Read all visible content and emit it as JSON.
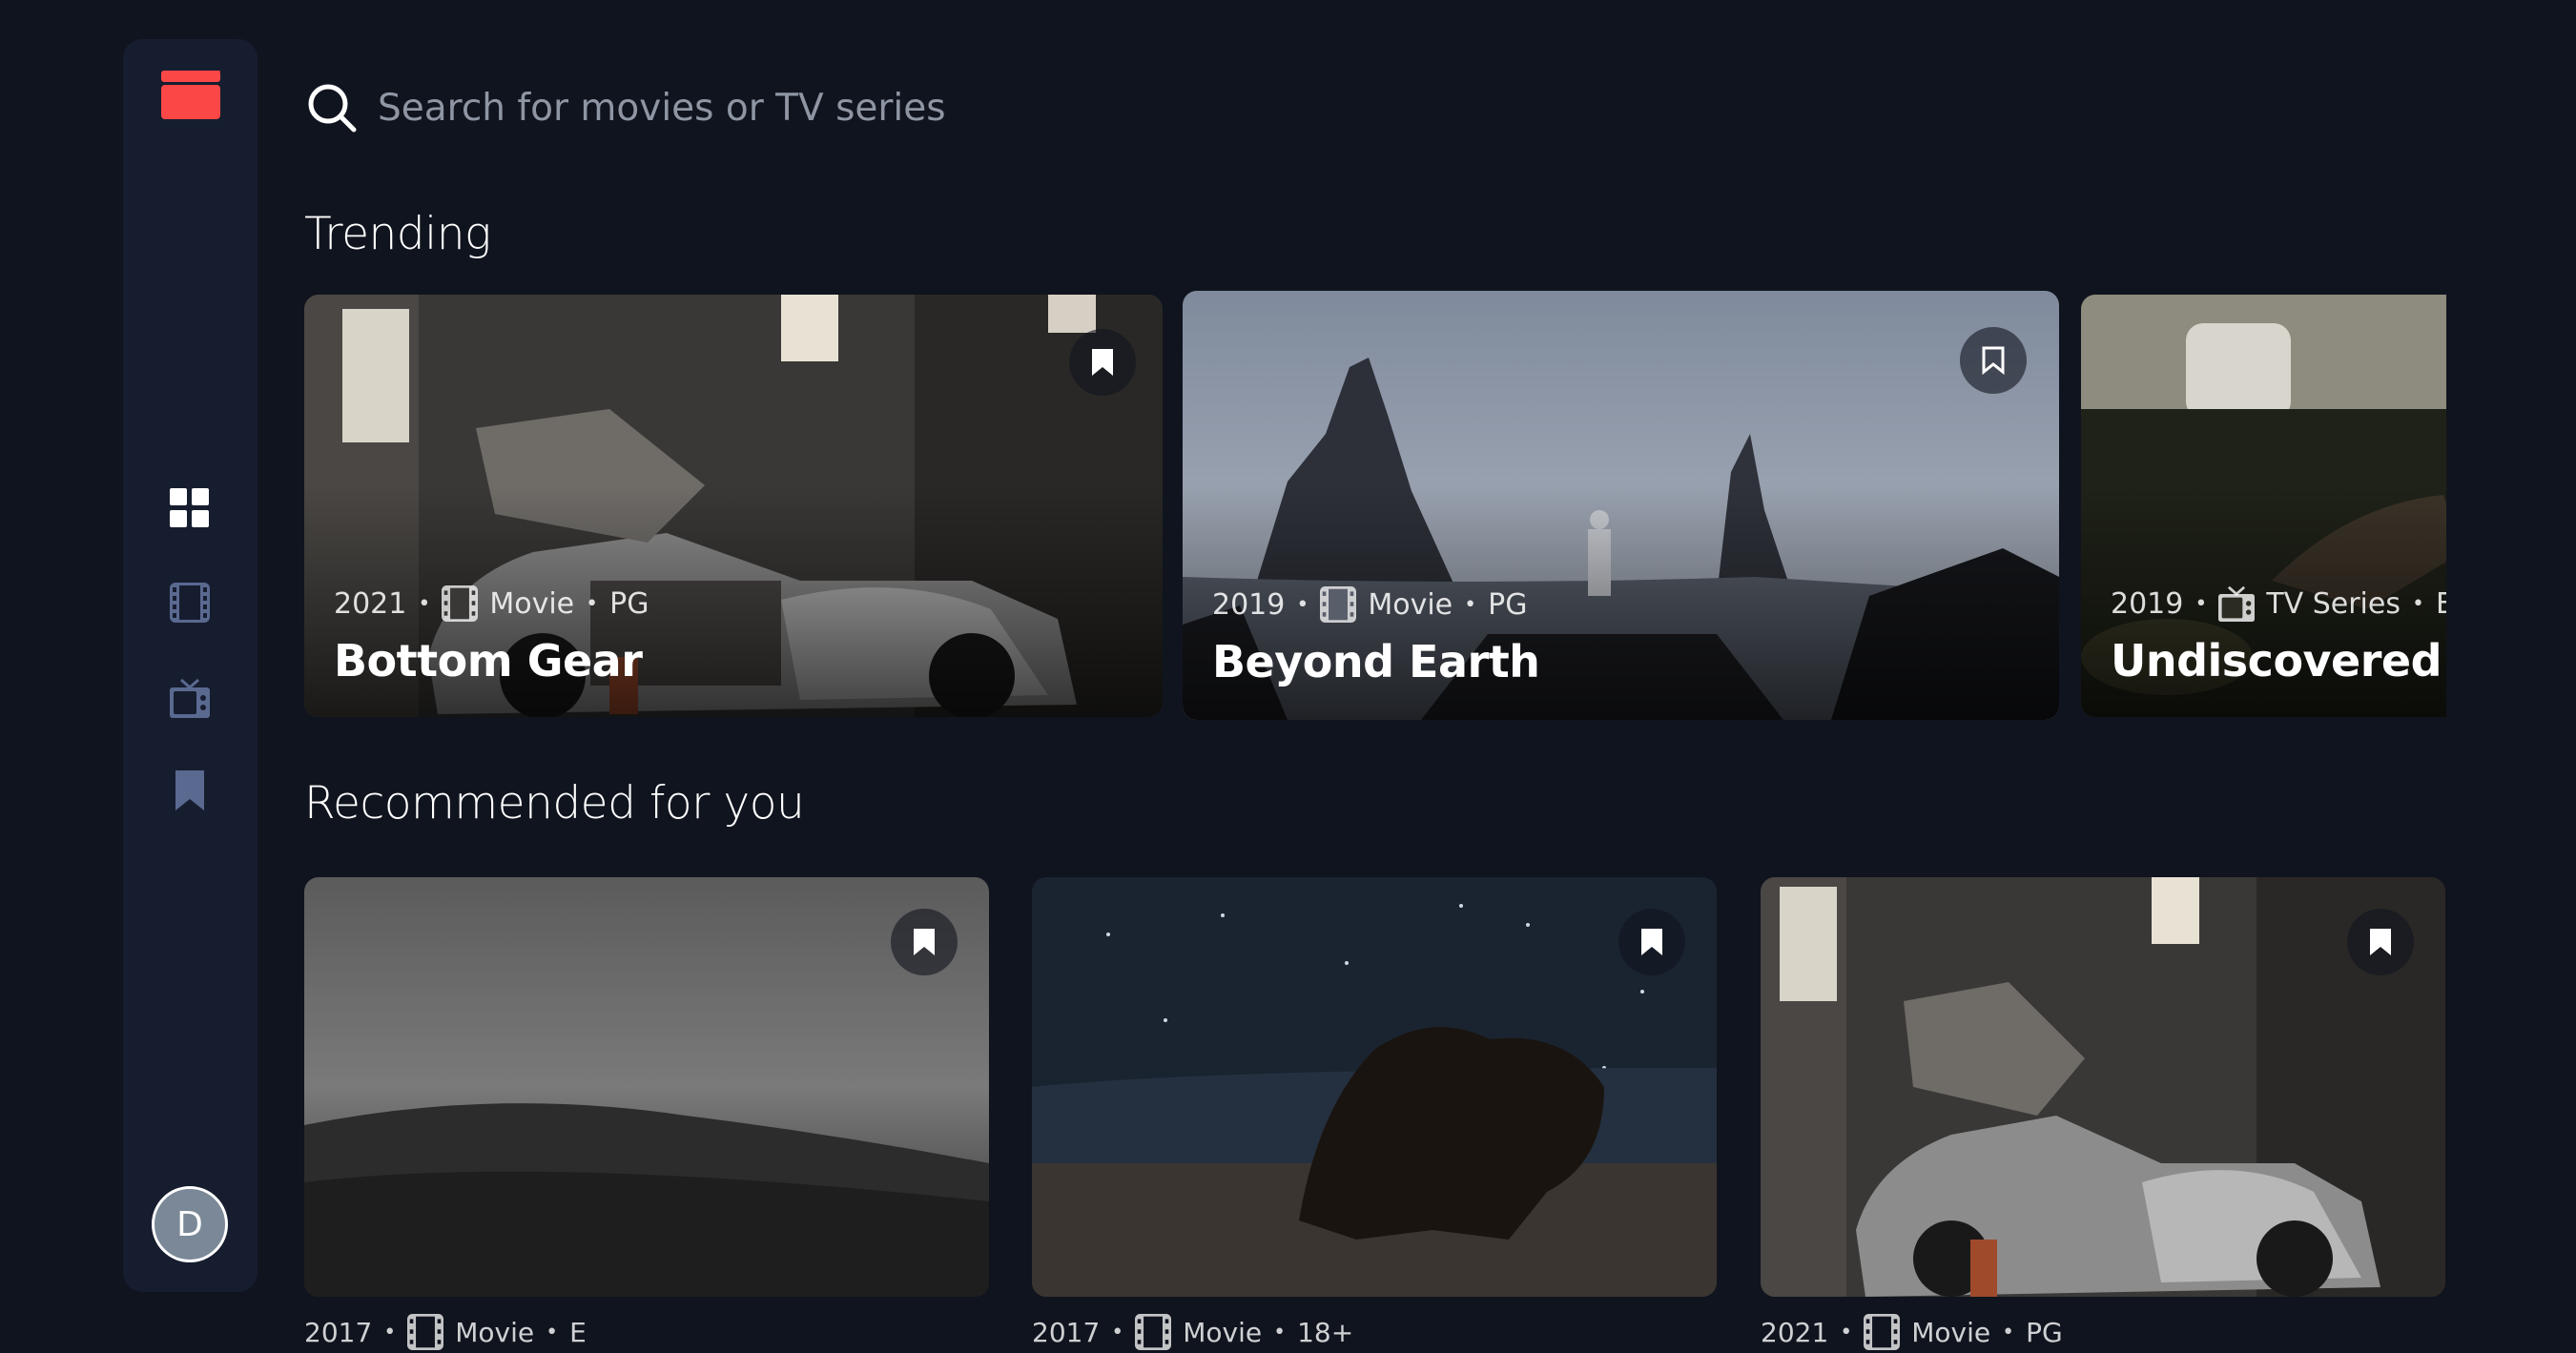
{
  "search": {
    "placeholder": "Search for movies or TV series",
    "icon": "search-icon"
  },
  "sidebar": {
    "logo_icon": "clapperboard-icon",
    "nav": [
      {
        "id": "home",
        "icon": "grid-icon",
        "active": true
      },
      {
        "id": "movies",
        "icon": "film-icon",
        "active": false
      },
      {
        "id": "tv-series",
        "icon": "tv-icon",
        "active": false
      },
      {
        "id": "bookmarks",
        "icon": "bookmark-icon",
        "active": false
      }
    ],
    "avatar_initial": "D"
  },
  "colors": {
    "accent": "#fc4747",
    "background": "#10141e",
    "sidebar": "#161d2f",
    "nav_inactive": "#5a698f"
  },
  "trending": {
    "title": "Trending",
    "items": [
      {
        "year": "2021",
        "category": "Movie",
        "rating": "PG",
        "title": "Bottom Gear"
      },
      {
        "year": "2019",
        "category": "Movie",
        "rating": "PG",
        "title": "Beyond Earth"
      },
      {
        "year": "2019",
        "category": "TV Series",
        "rating": "E",
        "title": "Undiscovered Cities"
      }
    ]
  },
  "recommended": {
    "title": "Recommended for you",
    "items": [
      {
        "year": "2017",
        "category": "Movie",
        "rating": "E"
      },
      {
        "year": "2017",
        "category": "Movie",
        "rating": "18+"
      },
      {
        "year": "2021",
        "category": "Movie",
        "rating": "PG"
      }
    ]
  }
}
